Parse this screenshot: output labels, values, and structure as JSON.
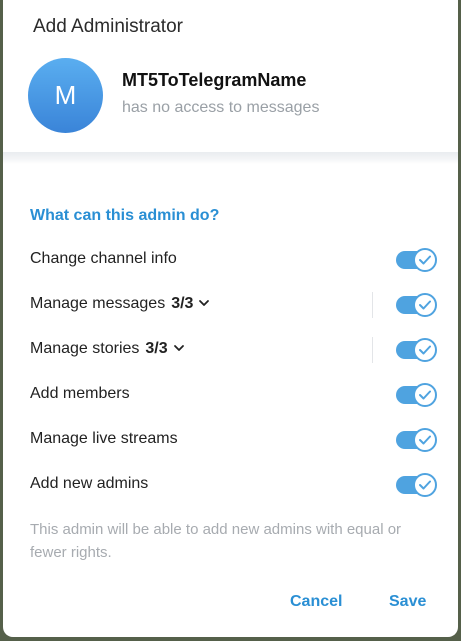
{
  "dialog": {
    "title": "Add Administrator"
  },
  "user": {
    "avatar_letter": "M",
    "name": "MT5ToTelegramName",
    "status": "has no access to messages"
  },
  "permissions": {
    "section_title": "What can this admin do?",
    "items": [
      {
        "label": "Change channel info",
        "enabled": true
      },
      {
        "label": "Manage messages",
        "count": "3/3",
        "expandable": true,
        "enabled": true
      },
      {
        "label": "Manage stories",
        "count": "3/3",
        "expandable": true,
        "enabled": true
      },
      {
        "label": "Add members",
        "enabled": true
      },
      {
        "label": "Manage live streams",
        "enabled": true
      },
      {
        "label": "Add new admins",
        "enabled": true
      }
    ],
    "note": "This admin will be able to add new admins with equal or fewer rights."
  },
  "buttons": {
    "cancel": "Cancel",
    "save": "Save"
  },
  "colors": {
    "accent": "#2a8fd4",
    "toggle_on": "#4fa3e0",
    "avatar": "#3f8fe0"
  }
}
